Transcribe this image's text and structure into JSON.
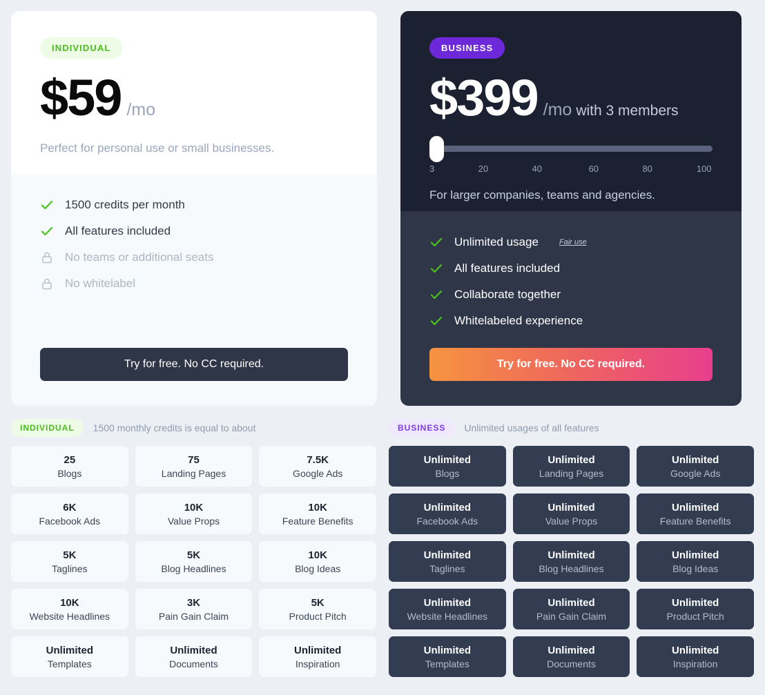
{
  "individual_card": {
    "badge": "INDIVIDUAL",
    "price": "$59",
    "period": "/mo",
    "tagline": "Perfect for personal use or small businesses.",
    "features": [
      {
        "icon": "check-icon",
        "label": "1500 credits per month",
        "included": true
      },
      {
        "icon": "check-icon",
        "label": "All features included",
        "included": true
      },
      {
        "icon": "lock-icon",
        "label": "No teams or additional seats",
        "included": false
      },
      {
        "icon": "lock-icon",
        "label": "No whitelabel",
        "included": false
      }
    ],
    "cta_label": "Try for free. No CC required."
  },
  "business_card": {
    "badge": "BUSINESS",
    "price": "$399",
    "period": "/mo",
    "period_suffix": "with 3 members",
    "slider": {
      "value": 3,
      "min": 3,
      "max": 100,
      "ticks": [
        "3",
        "20",
        "40",
        "60",
        "80",
        "100"
      ]
    },
    "tagline": "For larger companies, teams and agencies.",
    "features": [
      {
        "icon": "check-icon",
        "label": "Unlimited usage",
        "note": "Fair use"
      },
      {
        "icon": "check-icon",
        "label": "All features included"
      },
      {
        "icon": "check-icon",
        "label": "Collaborate together"
      },
      {
        "icon": "check-icon",
        "label": "Whitelabeled experience"
      }
    ],
    "cta_label": "Try for free. No CC required."
  },
  "individual_usage": {
    "badge": "INDIVIDUAL",
    "note": "1500 monthly credits is equal to about",
    "tiles": [
      {
        "value": "25",
        "label": "Blogs"
      },
      {
        "value": "75",
        "label": "Landing Pages"
      },
      {
        "value": "7.5K",
        "label": "Google Ads"
      },
      {
        "value": "6K",
        "label": "Facebook Ads"
      },
      {
        "value": "10K",
        "label": "Value Props"
      },
      {
        "value": "10K",
        "label": "Feature Benefits"
      },
      {
        "value": "5K",
        "label": "Taglines"
      },
      {
        "value": "5K",
        "label": "Blog Headlines"
      },
      {
        "value": "10K",
        "label": "Blog Ideas"
      },
      {
        "value": "10K",
        "label": "Website Headlines"
      },
      {
        "value": "3K",
        "label": "Pain Gain Claim"
      },
      {
        "value": "5K",
        "label": "Product Pitch"
      },
      {
        "value": "Unlimited",
        "label": "Templates"
      },
      {
        "value": "Unlimited",
        "label": "Documents"
      },
      {
        "value": "Unlimited",
        "label": "Inspiration"
      }
    ]
  },
  "business_usage": {
    "badge": "BUSINESS",
    "note": "Unlimited usages of all features",
    "tiles": [
      {
        "value": "Unlimited",
        "label": "Blogs"
      },
      {
        "value": "Unlimited",
        "label": "Landing Pages"
      },
      {
        "value": "Unlimited",
        "label": "Google Ads"
      },
      {
        "value": "Unlimited",
        "label": "Facebook Ads"
      },
      {
        "value": "Unlimited",
        "label": "Value Props"
      },
      {
        "value": "Unlimited",
        "label": "Feature Benefits"
      },
      {
        "value": "Unlimited",
        "label": "Taglines"
      },
      {
        "value": "Unlimited",
        "label": "Blog Headlines"
      },
      {
        "value": "Unlimited",
        "label": "Blog Ideas"
      },
      {
        "value": "Unlimited",
        "label": "Website Headlines"
      },
      {
        "value": "Unlimited",
        "label": "Pain Gain Claim"
      },
      {
        "value": "Unlimited",
        "label": "Product Pitch"
      },
      {
        "value": "Unlimited",
        "label": "Templates"
      },
      {
        "value": "Unlimited",
        "label": "Documents"
      },
      {
        "value": "Unlimited",
        "label": "Inspiration"
      }
    ]
  },
  "colors": {
    "page_bg": "#eceff4",
    "individual_accent": "#49bd1e",
    "business_accent": "#6d28d9",
    "dark_card": "#1b2130",
    "dark_card_lower": "#2e3648",
    "check_green": "#4ac21c",
    "cta_gradient_start": "#f59440",
    "cta_gradient_end": "#e83e8c"
  }
}
